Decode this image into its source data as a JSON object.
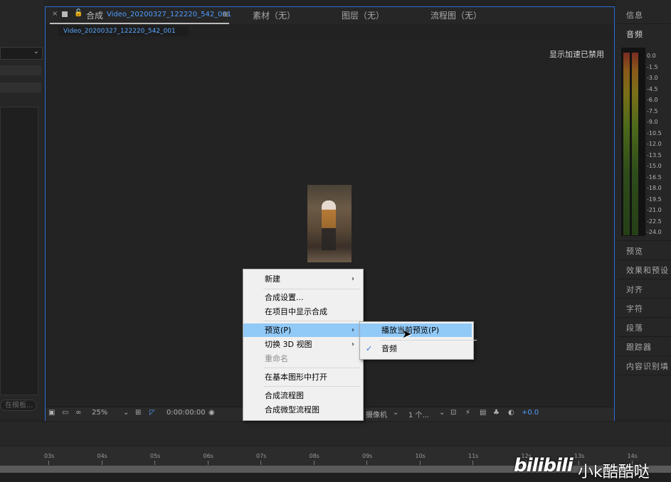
{
  "left_panel": {
    "search_placeholder": "在模板..."
  },
  "comp_panel": {
    "tab_close": "×",
    "tab_label": "合成",
    "tab_comp_name": "Video_20200327_122220_542_001",
    "tab_menu": "≡",
    "sub_tab": "Video_20200327_122220_542_001",
    "footage_tab": "素材（无）",
    "layer_tab": "图层（无）",
    "flowchart_tab": "流程图（无）",
    "accel_status": "显示加速已禁用"
  },
  "viewer_bar": {
    "zoom": "25%",
    "timecode": "0:00:00:00",
    "camera": "摄像机",
    "views": "1 个...",
    "exposure": "+0.0"
  },
  "right_panel": {
    "info": "信息",
    "audio": "音频",
    "preview": "预览",
    "effects": "效果和预设",
    "align": "对齐",
    "character": "字符",
    "paragraph": "段落",
    "tracker": "跟踪器",
    "content_aware": "内容识别填",
    "db_ticks": [
      "0.0",
      "-1.5",
      "-3.0",
      "-4.5",
      "-6.0",
      "-7.5",
      "-9.0",
      "-10.5",
      "-12.0",
      "-13.5",
      "-15.0",
      "-16.5",
      "-18.0",
      "-19.5",
      "-21.0",
      "-22.5",
      "-24.0"
    ]
  },
  "timeline": {
    "ruler": [
      "03s",
      "04s",
      "05s",
      "06s",
      "07s",
      "08s",
      "09s",
      "10s",
      "11s",
      "12s",
      "13s",
      "14s"
    ]
  },
  "watermark": {
    "logo": "bilibili",
    "text": "小k酷酷哒"
  },
  "context_menu": {
    "new": "新建",
    "comp_settings": "合成设置...",
    "reveal_in_project": "在项目中显示合成",
    "preview": "预览(P)",
    "switch_3d": "切换 3D 视图",
    "rename": "重命名",
    "open_essential": "在基本图形中打开",
    "comp_flowchart": "合成流程图",
    "comp_mini_flowchart": "合成微型流程图"
  },
  "submenu": {
    "play_current": "播放当前预览(P)",
    "audio": "音频"
  }
}
